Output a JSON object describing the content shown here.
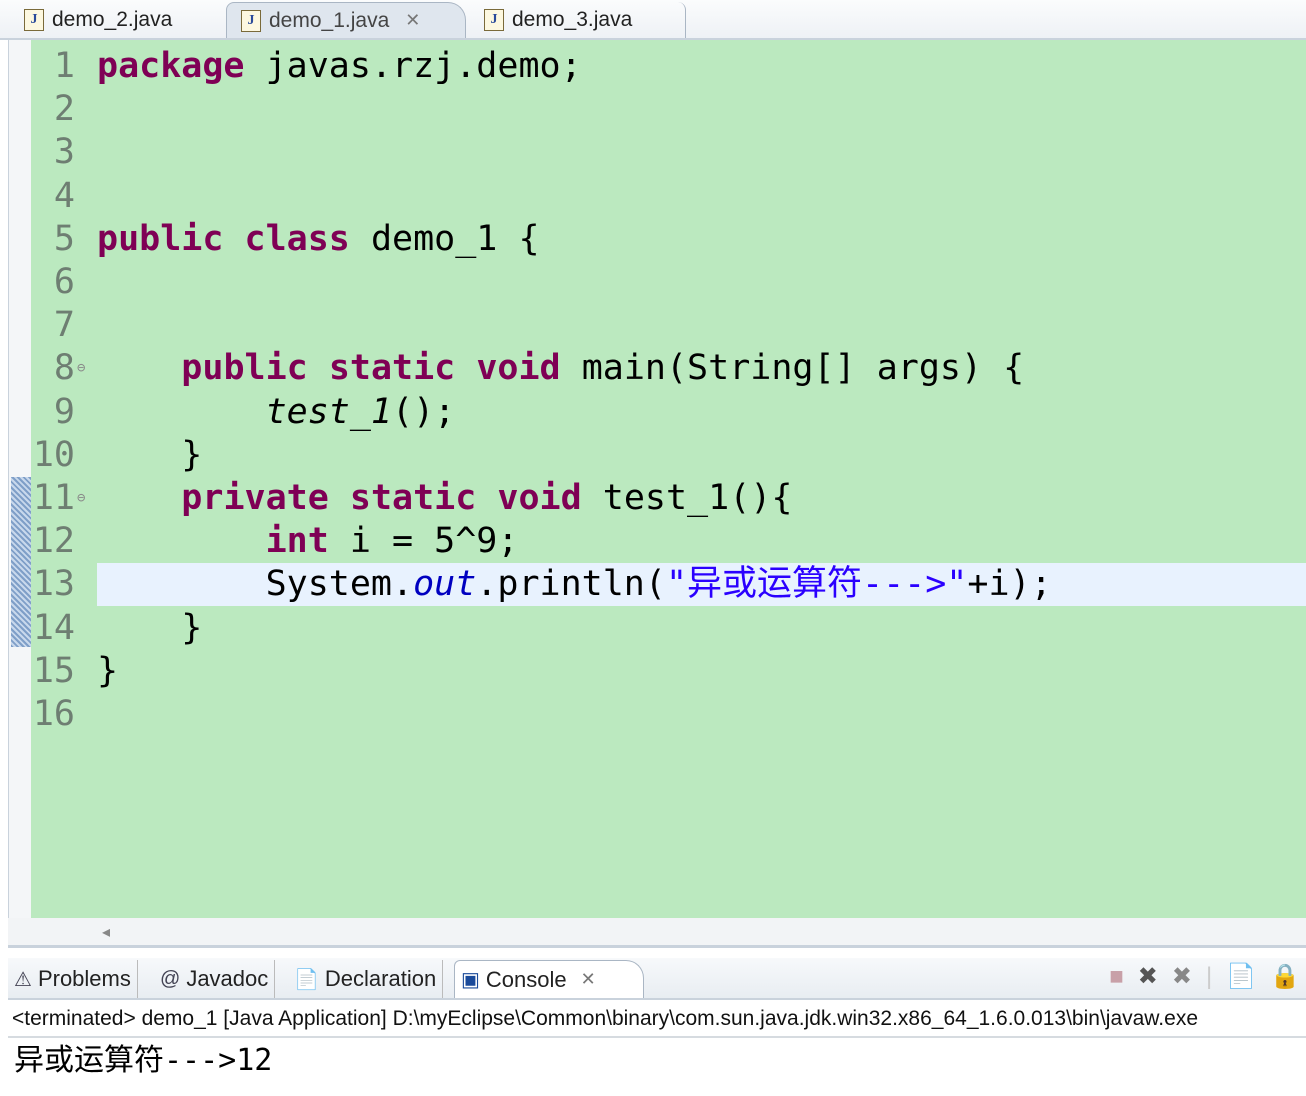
{
  "editor_tabs": [
    {
      "label": "demo_2.java",
      "active": false
    },
    {
      "label": "demo_1.java",
      "active": true
    },
    {
      "label": "demo_3.java",
      "active": false
    }
  ],
  "code": {
    "current_line": 13,
    "folds": [
      8,
      11
    ],
    "lines": [
      [
        {
          "t": "package",
          "c": "kw"
        },
        {
          "t": " javas.rzj.demo;"
        }
      ],
      [],
      [],
      [],
      [
        {
          "t": "public",
          "c": "kw"
        },
        {
          "t": " "
        },
        {
          "t": "class",
          "c": "kw"
        },
        {
          "t": " demo_1 {"
        }
      ],
      [],
      [],
      [
        {
          "t": "    "
        },
        {
          "t": "public",
          "c": "kw"
        },
        {
          "t": " "
        },
        {
          "t": "static",
          "c": "kw"
        },
        {
          "t": " "
        },
        {
          "t": "void",
          "c": "kw"
        },
        {
          "t": " main(String[] args) {"
        }
      ],
      [
        {
          "t": "        "
        },
        {
          "t": "test_1",
          "c": "it"
        },
        {
          "t": "();"
        }
      ],
      [
        {
          "t": "    }"
        }
      ],
      [
        {
          "t": "    "
        },
        {
          "t": "private",
          "c": "kw"
        },
        {
          "t": " "
        },
        {
          "t": "static",
          "c": "kw"
        },
        {
          "t": " "
        },
        {
          "t": "void",
          "c": "kw"
        },
        {
          "t": " test_1(){"
        }
      ],
      [
        {
          "t": "        "
        },
        {
          "t": "int",
          "c": "kw"
        },
        {
          "t": " i = 5^9;"
        }
      ],
      [
        {
          "t": "        System."
        },
        {
          "t": "out",
          "c": "fld"
        },
        {
          "t": ".println("
        },
        {
          "t": "\"异或运算符--->\"",
          "c": "str"
        },
        {
          "t": "+i);"
        }
      ],
      [
        {
          "t": "    }"
        }
      ],
      [
        {
          "t": "}"
        }
      ],
      []
    ]
  },
  "console_tabs": [
    {
      "label": "Problems",
      "icon": "problems-icon"
    },
    {
      "label": "Javadoc",
      "icon": "at-icon"
    },
    {
      "label": "Declaration",
      "icon": "declaration-icon"
    },
    {
      "label": "Console",
      "icon": "console-icon",
      "active": true
    }
  ],
  "console": {
    "status": "<terminated> demo_1 [Java Application] D:\\myEclipse\\Common\\binary\\com.sun.java.jdk.win32.x86_64_1.6.0.013\\bin\\javaw.exe",
    "output": "异或运算符--->12"
  }
}
